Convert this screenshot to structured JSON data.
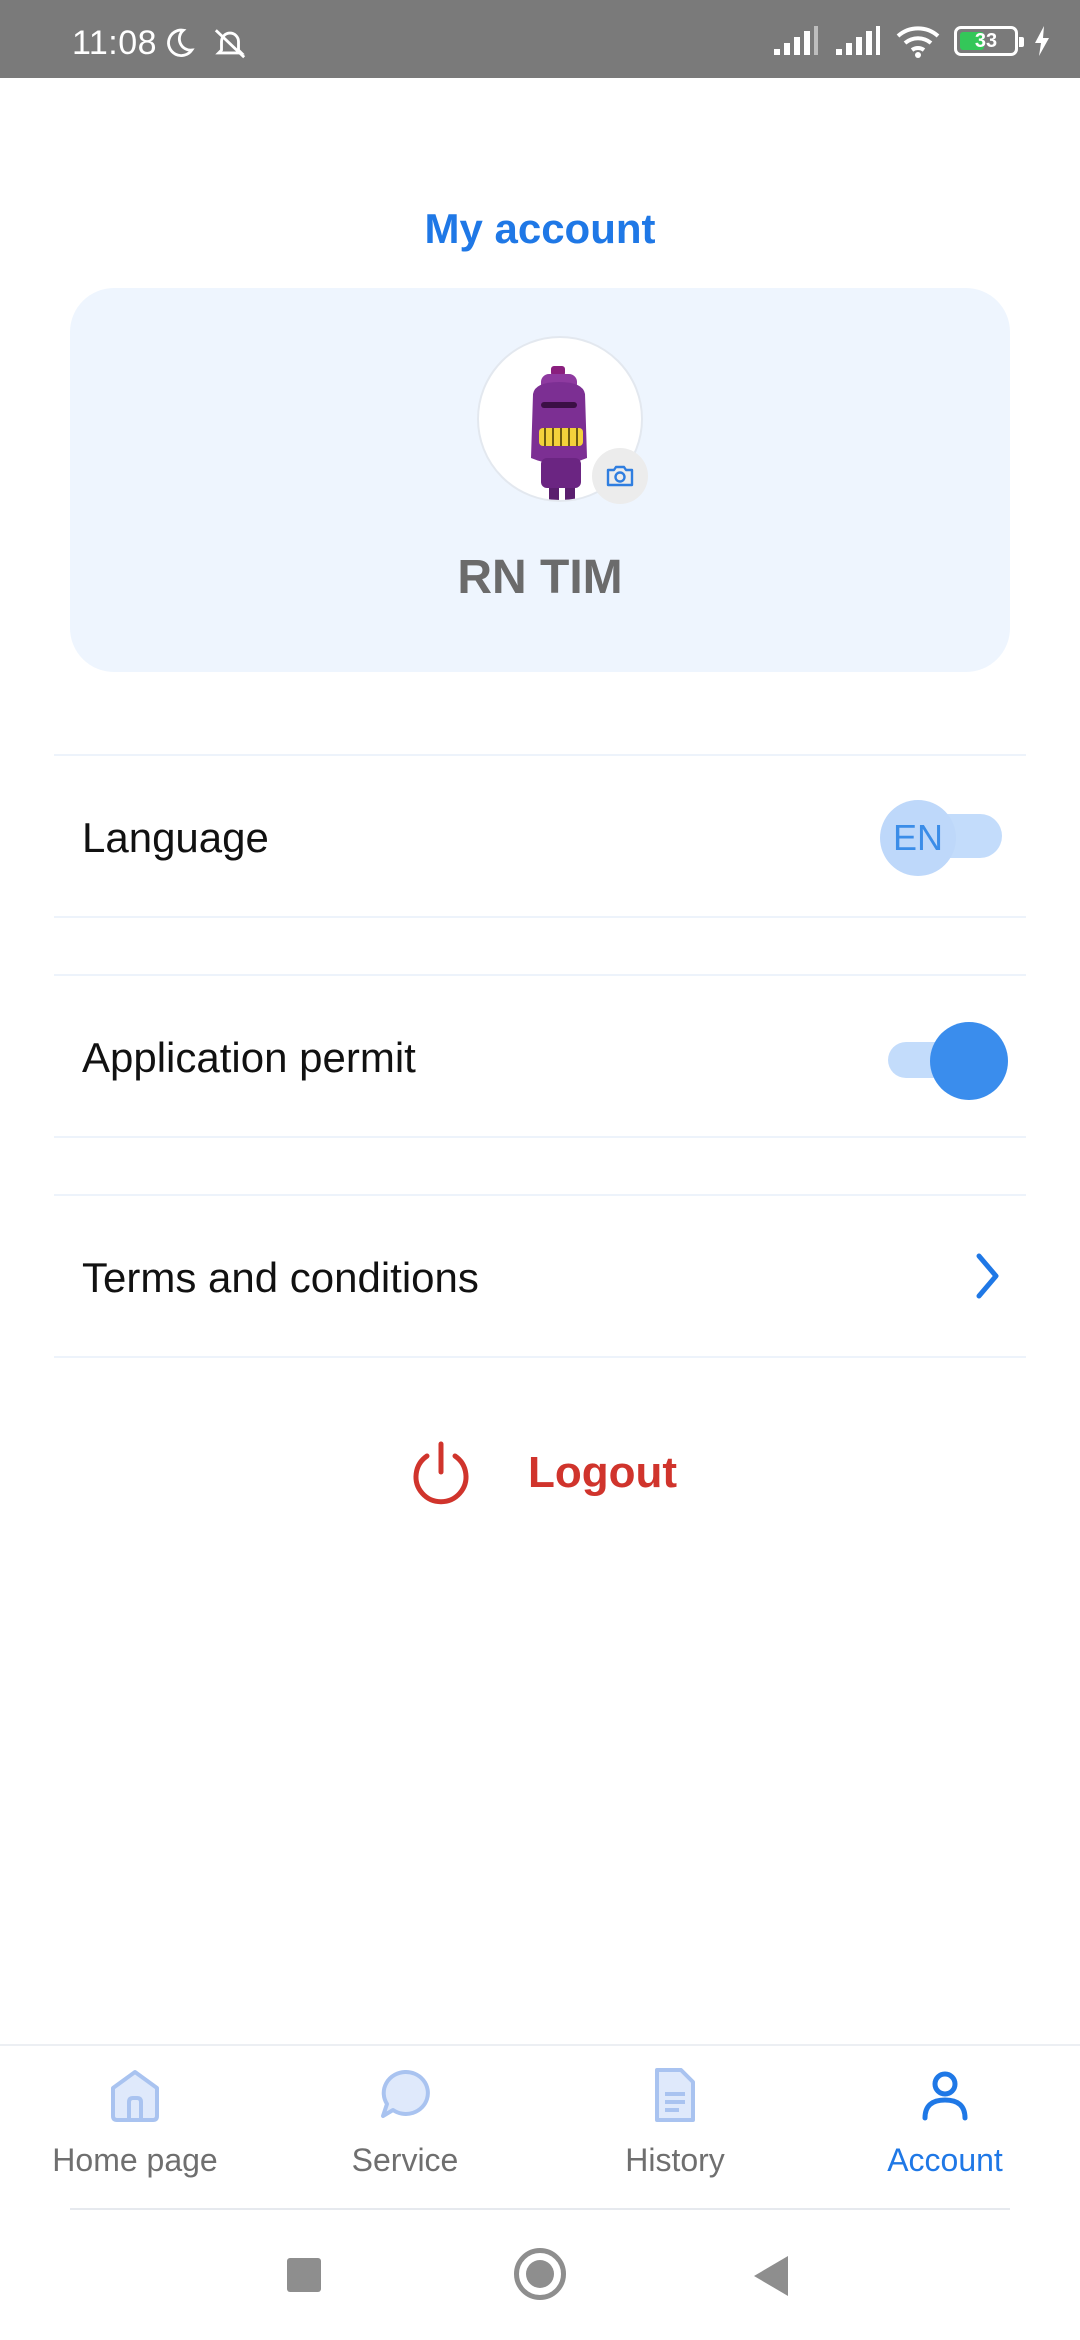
{
  "status_bar": {
    "time": "11:08",
    "battery_level": "33",
    "icons": [
      "moon-icon",
      "mute-alarm-icon",
      "signal-icon",
      "signal-icon",
      "wifi-icon",
      "battery-icon",
      "charging-icon"
    ]
  },
  "header": {
    "title": "My account"
  },
  "profile": {
    "name": "RN TIM",
    "avatar_icon": "robot-avatar",
    "badge_icon": "camera-icon"
  },
  "settings": {
    "language": {
      "label": "Language",
      "value": "EN"
    },
    "permit": {
      "label": "Application permit",
      "enabled": true
    },
    "terms": {
      "label": "Terms and conditions",
      "icon": "chevron-right-icon"
    }
  },
  "logout": {
    "label": "Logout",
    "icon": "power-icon"
  },
  "bottom_nav": {
    "items": [
      {
        "label": "Home page",
        "icon": "home-icon",
        "active": false
      },
      {
        "label": "Service",
        "icon": "chat-icon",
        "active": false
      },
      {
        "label": "History",
        "icon": "document-icon",
        "active": false
      },
      {
        "label": "Account",
        "icon": "user-icon",
        "active": true
      }
    ]
  },
  "colors": {
    "accent": "#1f78e6",
    "logout": "#d0342c",
    "card_bg": "#eef5fe"
  }
}
